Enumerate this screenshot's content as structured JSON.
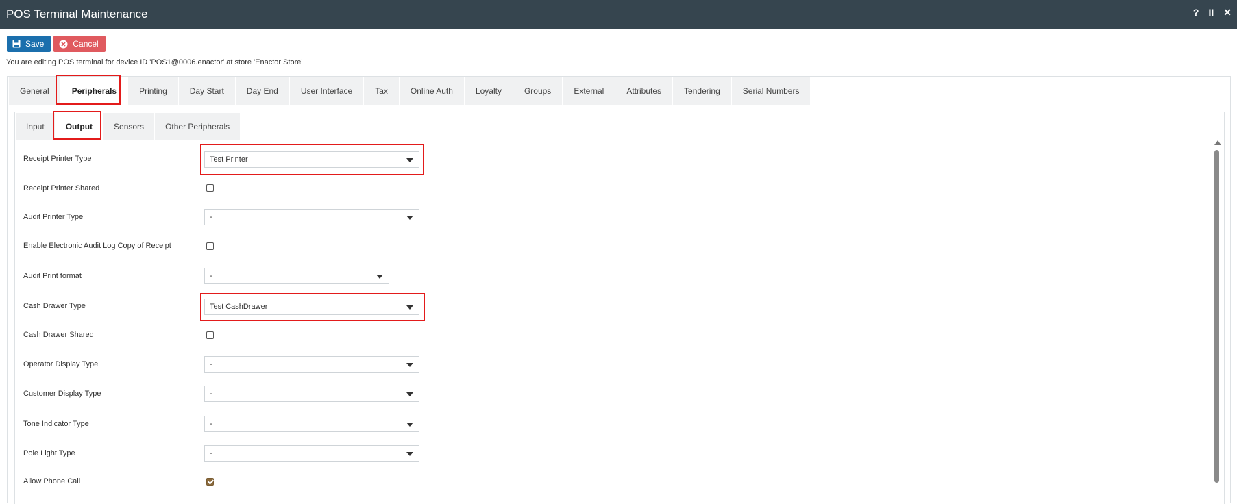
{
  "window": {
    "title": "POS Terminal Maintenance",
    "controls": [
      "?",
      "II",
      "✕"
    ]
  },
  "toolbar": {
    "save_label": "Save",
    "cancel_label": "Cancel"
  },
  "info_text": "You are editing POS terminal for device ID 'POS1@0006.enactor' at store 'Enactor Store'",
  "tabs": [
    "General",
    "Peripherals",
    "Printing",
    "Day Start",
    "Day End",
    "User Interface",
    "Tax",
    "Online Auth",
    "Loyalty",
    "Groups",
    "External",
    "Attributes",
    "Tendering",
    "Serial Numbers"
  ],
  "active_tab": "Peripherals",
  "subtabs": [
    "Input",
    "Output",
    "Sensors",
    "Other Peripherals"
  ],
  "active_subtab": "Output",
  "fields": {
    "receipt_printer_type": {
      "label": "Receipt Printer Type",
      "value": "Test Printer"
    },
    "receipt_printer_shared": {
      "label": "Receipt Printer Shared",
      "checked": false
    },
    "audit_printer_type": {
      "label": "Audit Printer Type",
      "value": "-"
    },
    "enable_electronic_audit": {
      "label": "Enable Electronic Audit Log Copy of Receipt",
      "checked": false
    },
    "audit_print_format": {
      "label": "Audit Print format",
      "value": "-"
    },
    "cash_drawer_type": {
      "label": "Cash Drawer Type",
      "value": "Test CashDrawer"
    },
    "cash_drawer_shared": {
      "label": "Cash Drawer Shared",
      "checked": false
    },
    "operator_display_type": {
      "label": "Operator Display Type",
      "value": "-"
    },
    "customer_display_type": {
      "label": "Customer Display Type",
      "value": "-"
    },
    "tone_indicator_type": {
      "label": "Tone Indicator Type",
      "value": "-"
    },
    "pole_light_type": {
      "label": "Pole Light Type",
      "value": "-"
    },
    "allow_phone_call": {
      "label": "Allow Phone Call",
      "checked": true
    }
  },
  "colors": {
    "titlebar": "#36454f",
    "save": "#1b6fad",
    "cancel": "#e05a5f",
    "highlight": "#e31b1b",
    "checkbox_checked": "#8b6b3e"
  }
}
